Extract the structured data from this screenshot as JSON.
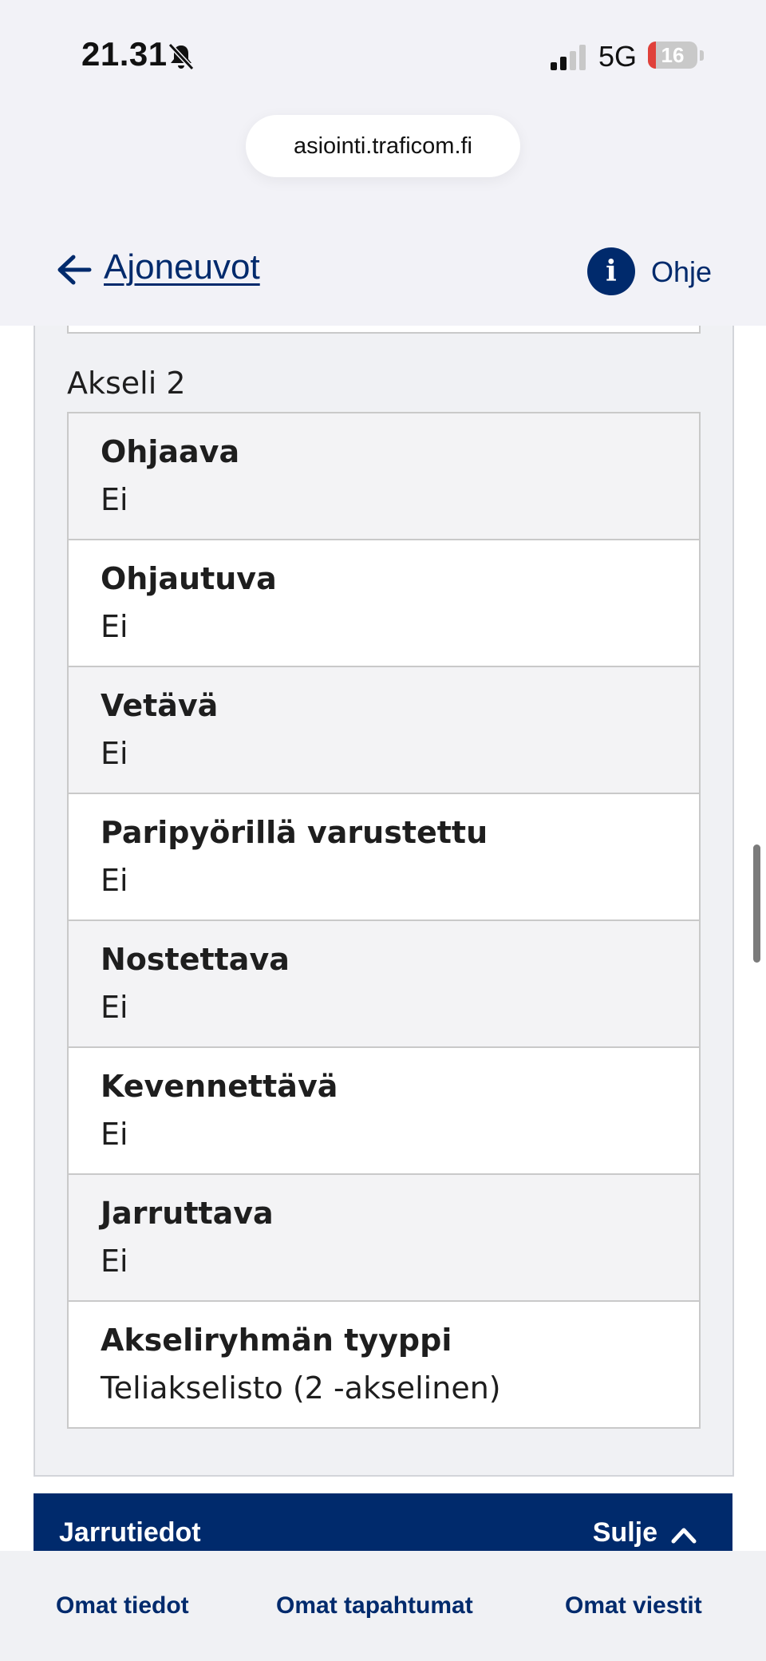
{
  "status_bar": {
    "time": "21.31",
    "network": "5G",
    "battery_level": "16",
    "battery_fraction": 0.16,
    "icons": [
      "bell-slash-icon",
      "signal-icon",
      "battery-icon"
    ]
  },
  "browser": {
    "url": "asiointi.traficom.fi"
  },
  "header": {
    "back_icon": "arrow-left-icon",
    "title": "Ajoneuvot",
    "help_icon": "info-icon",
    "help_icon_glyph": "i",
    "help_label": "Ohje"
  },
  "axle": {
    "title": "Akseli 2",
    "rows": [
      {
        "label": "Ohjaava",
        "value": "Ei"
      },
      {
        "label": "Ohjautuva",
        "value": "Ei"
      },
      {
        "label": "Vetävä",
        "value": "Ei"
      },
      {
        "label": "Paripyörillä varustettu",
        "value": "Ei"
      },
      {
        "label": "Nostettava",
        "value": "Ei"
      },
      {
        "label": "Kevennettävä",
        "value": "Ei"
      },
      {
        "label": "Jarruttava",
        "value": "Ei"
      },
      {
        "label": "Akseliryhmän tyyppi",
        "value": "Teliakselisto (2 -akselinen)"
      }
    ]
  },
  "brake_section": {
    "title": "Jarrutiedot",
    "toggle_label": "Sulje",
    "toggle_icon": "chevron-up-icon"
  },
  "bottom_nav": {
    "items": [
      {
        "label": "Omat tiedot"
      },
      {
        "label": "Omat tapahtumat"
      },
      {
        "label": "Omat viestit"
      }
    ]
  },
  "colors": {
    "brand_navy": "#002a6c",
    "panel_bg": "#f0f1f4",
    "row_alt": "#f3f3f5",
    "border": "#c9c9c9",
    "battery_red": "#e0413a"
  }
}
